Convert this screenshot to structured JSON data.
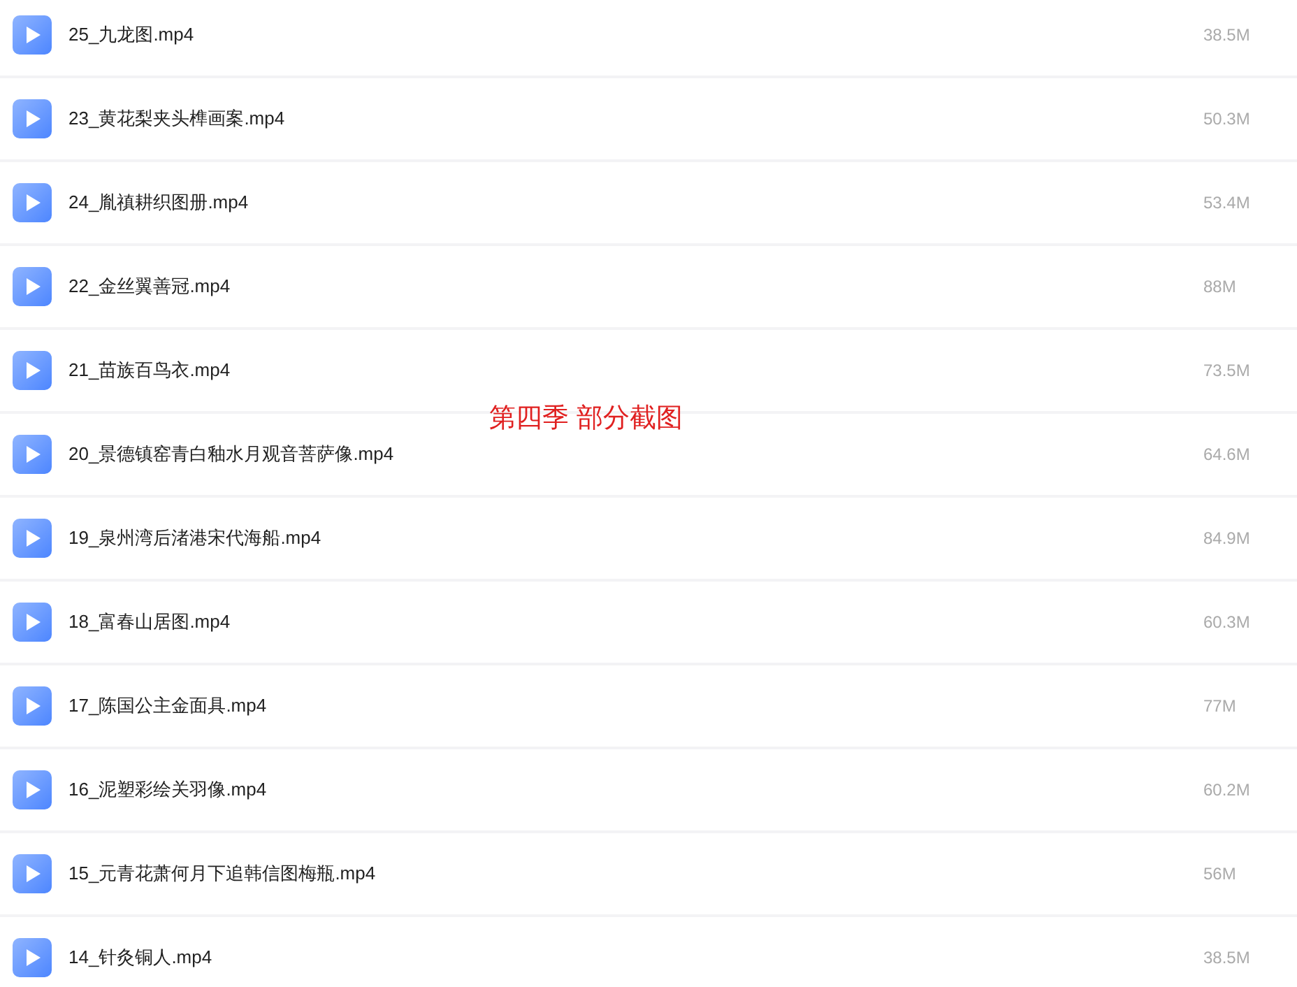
{
  "files": [
    {
      "name": "25_九龙图.mp4",
      "size": "38.5M"
    },
    {
      "name": "23_黄花梨夹头榫画案.mp4",
      "size": "50.3M"
    },
    {
      "name": "24_胤禛耕织图册.mp4",
      "size": "53.4M"
    },
    {
      "name": "22_金丝翼善冠.mp4",
      "size": "88M"
    },
    {
      "name": "21_苗族百鸟衣.mp4",
      "size": "73.5M"
    },
    {
      "name": "20_景德镇窑青白釉水月观音菩萨像.mp4",
      "size": "64.6M"
    },
    {
      "name": "19_泉州湾后渚港宋代海船.mp4",
      "size": "84.9M"
    },
    {
      "name": "18_富春山居图.mp4",
      "size": "60.3M"
    },
    {
      "name": "17_陈国公主金面具.mp4",
      "size": "77M"
    },
    {
      "name": "16_泥塑彩绘关羽像.mp4",
      "size": "60.2M"
    },
    {
      "name": "15_元青花萧何月下追韩信图梅瓶.mp4",
      "size": "56M"
    },
    {
      "name": "14_针灸铜人.mp4",
      "size": "38.5M"
    }
  ],
  "caption": "第四季 部分截图"
}
